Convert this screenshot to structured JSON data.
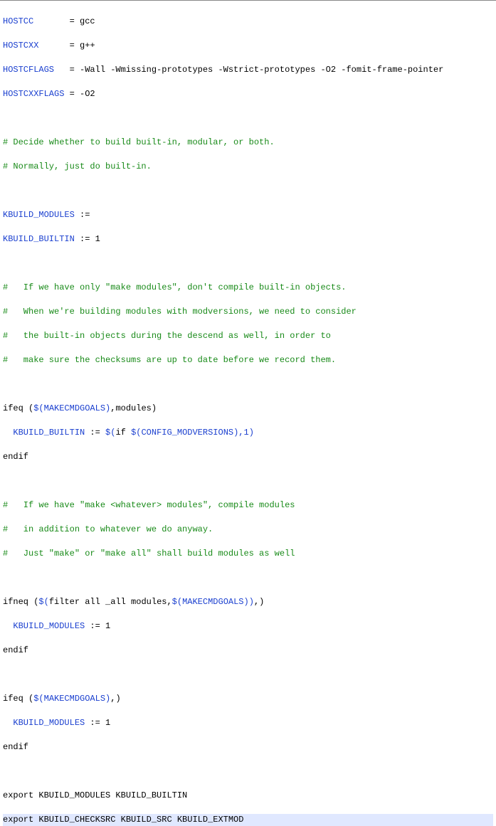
{
  "variables": {
    "hostcc_k": "HOSTCC",
    "hostcxx_k": "HOSTCXX",
    "hostcflags_k": "HOSTCFLAGS",
    "hostcxxflags_k": "HOSTCXXFLAGS",
    "kbuild_modules_k": "KBUILD_MODULES",
    "kbuild_builtin_k": "KBUILD_BUILTIN"
  },
  "assign": {
    "hostcc_eq": "       = gcc",
    "hostcxx_eq": "      = g++",
    "hostcflags_eq": "   = -Wall -Wmissing-prototypes -Wstrict-prototypes -O2 -fomit-frame-pointer",
    "hostcxxflags_eq": " = -O2",
    "kbuild_modules_eq": " :=",
    "kbuild_builtin_eq": " := 1"
  },
  "comments": {
    "c1": "# Decide whether to build built-in, modular, or both.",
    "c2": "# Normally, just do built-in.",
    "c3": "#   If we have only \"make modules\", don't compile built-in objects.",
    "c4": "#   When we're building modules with modversions, we need to consider",
    "c5": "#   the built-in objects during the descend as well, in order to",
    "c6": "#   make sure the checksums are up to date before we record them.",
    "c7": "#   If we have \"make <whatever> modules\", compile modules",
    "c8": "#   in addition to whatever we do anyway.",
    "c9": "#   Just \"make\" or \"make all\" shall build modules as well"
  },
  "ifeq1": {
    "kw_ifeq": "ifeq ",
    "open": "(",
    "fn1": "$(",
    "var1": "MAKECMDGOALS",
    "fn1_close": ")",
    "rest": ",modules)",
    "indent": "  ",
    "lhs": "KBUILD_BUILTIN",
    "mid": " := ",
    "rhs_fn_open": "$(",
    "rhs_if": "if ",
    "rhs_fn2_open": "$(",
    "rhs_var2": "CONFIG_MODVERSIONS",
    "rhs_fn2_close": ")",
    "rhs_tail": ",1)",
    "endif": "endif"
  },
  "ifneq": {
    "kw": "ifneq ",
    "open": "(",
    "fn_open": "$(",
    "filter": "filter",
    "args": " all _all modules,",
    "fn2_open": "$(",
    "var": "MAKECMDGOALS",
    "fn2_close": ")",
    "fn_close": ")",
    "tail": ",)",
    "indent": "  ",
    "lhs": "KBUILD_MODULES",
    "rhs": " := 1",
    "endif": "endif"
  },
  "ifeq2": {
    "kw": "ifeq ",
    "open": "(",
    "fn_open": "$(",
    "var": "MAKECMDGOALS",
    "fn_close": ")",
    "tail": ",)",
    "indent": "  ",
    "lhs": "KBUILD_MODULES",
    "rhs": " := 1",
    "endif": "endif"
  },
  "exports": {
    "e1": "export KBUILD_MODULES KBUILD_BUILTIN",
    "e2": "export KBUILD_CHECKSRC KBUILD_SRC KBUILD_EXTMOD"
  }
}
